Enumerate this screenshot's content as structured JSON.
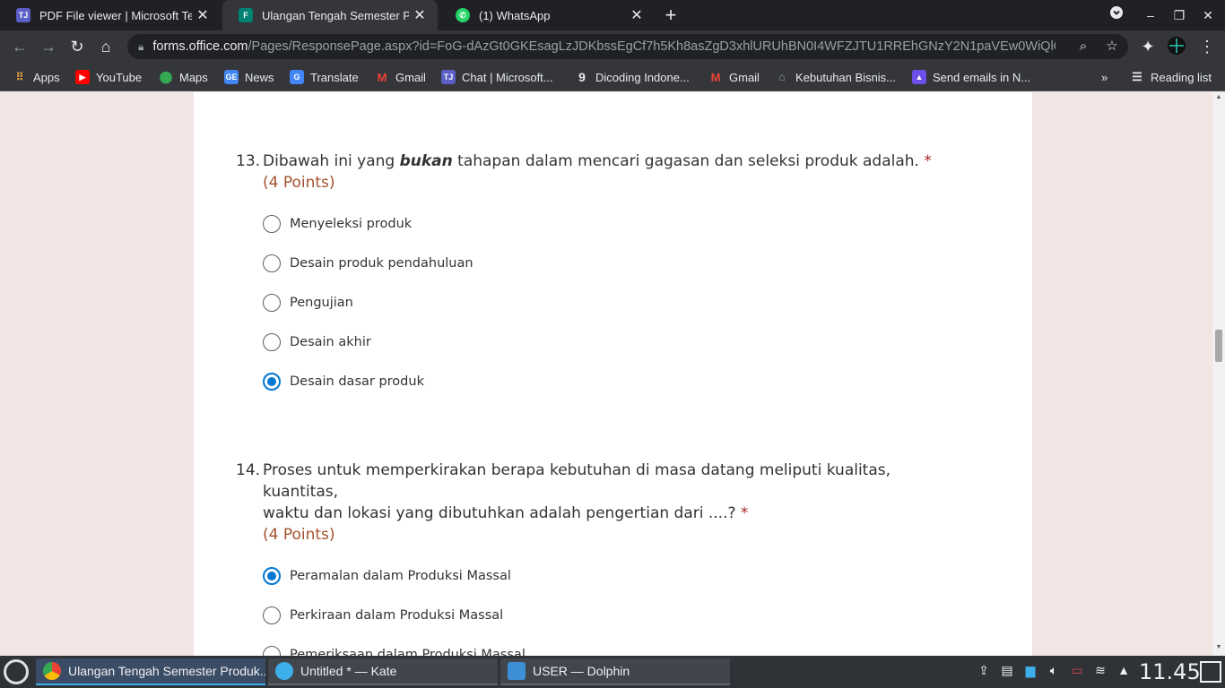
{
  "browser": {
    "tabs": [
      {
        "title": "PDF File viewer | Microsoft Teams",
        "icon": "teams-icon",
        "active": false
      },
      {
        "title": "Ulangan Tengah Semester Produk Kreatif",
        "icon": "forms-icon",
        "active": true
      },
      {
        "title": "(1) WhatsApp",
        "icon": "whatsapp-icon",
        "active": false
      }
    ],
    "url_host": "forms.office.com",
    "url_path": "/Pages/ResponsePage.aspx?id=FoG-dAzGt0GKEsagLzJDKbssEgCf7h5Kh8asZgD3xhlURUhBN0I4WFZJTU1RREhGNzY2N1paVEw0WiQlQC...",
    "bookmarks": [
      {
        "label": "Apps",
        "icon": "apps-grid-icon"
      },
      {
        "label": "YouTube",
        "icon": "youtube-icon"
      },
      {
        "label": "Maps",
        "icon": "maps-icon"
      },
      {
        "label": "News",
        "icon": "news-icon"
      },
      {
        "label": "Translate",
        "icon": "translate-icon"
      },
      {
        "label": "Gmail",
        "icon": "gmail-icon"
      },
      {
        "label": "Chat | Microsoft...",
        "icon": "teams-icon"
      },
      {
        "label": "Dicoding Indone...",
        "icon": "dicoding-icon"
      },
      {
        "label": "Gmail",
        "icon": "gmail-icon"
      },
      {
        "label": "Kebutuhan Bisnis...",
        "icon": "bisnis-icon"
      },
      {
        "label": "Send emails in N...",
        "icon": "send-icon"
      }
    ],
    "overflow": "»",
    "reading_list": "Reading list"
  },
  "form": {
    "questions": [
      {
        "number": "13.",
        "text_before": "Dibawah ini yang ",
        "text_emphasis": "bukan",
        "text_after": " tahapan dalam mencari gagasan dan seleksi produk adalah.",
        "required": "*",
        "points": "(4 Points)",
        "options": [
          {
            "label": "Menyeleksi produk",
            "selected": false
          },
          {
            "label": "Desain produk pendahuluan",
            "selected": false
          },
          {
            "label": "Pengujian",
            "selected": false
          },
          {
            "label": "Desain akhir",
            "selected": false
          },
          {
            "label": "Desain dasar produk",
            "selected": true
          }
        ]
      },
      {
        "number": "14.",
        "text_line1": "Proses untuk memperkirakan berapa kebutuhan di masa datang meliputi kualitas, kuantitas,",
        "text_line2": "waktu dan lokasi yang dibutuhkan adalah pengertian dari ....?",
        "required": "*",
        "points": "(4 Points)",
        "options": [
          {
            "label": "Peramalan dalam Produksi Massal",
            "selected": true
          },
          {
            "label": "Perkiraan dalam Produksi Massal",
            "selected": false
          },
          {
            "label": "Pemeriksaan dalam Produksi Massal",
            "selected": false
          }
        ]
      }
    ]
  },
  "taskbar": {
    "tasks": [
      {
        "label": "Ulangan Tengah Semester Produk...",
        "icon": "chrome-icon",
        "active": true
      },
      {
        "label": "Untitled * — Kate",
        "icon": "kate-icon",
        "active": false
      },
      {
        "label": "USER — Dolphin",
        "icon": "dolphin-icon",
        "active": false
      }
    ],
    "clock": "11.45"
  },
  "colors": {
    "accent": "#0078d4",
    "required": "#a4262c",
    "points": "#a4502c",
    "page_bg": "#f1e6e4",
    "tab_active_bg": "#35363a",
    "tab_strip_bg": "#202124"
  }
}
